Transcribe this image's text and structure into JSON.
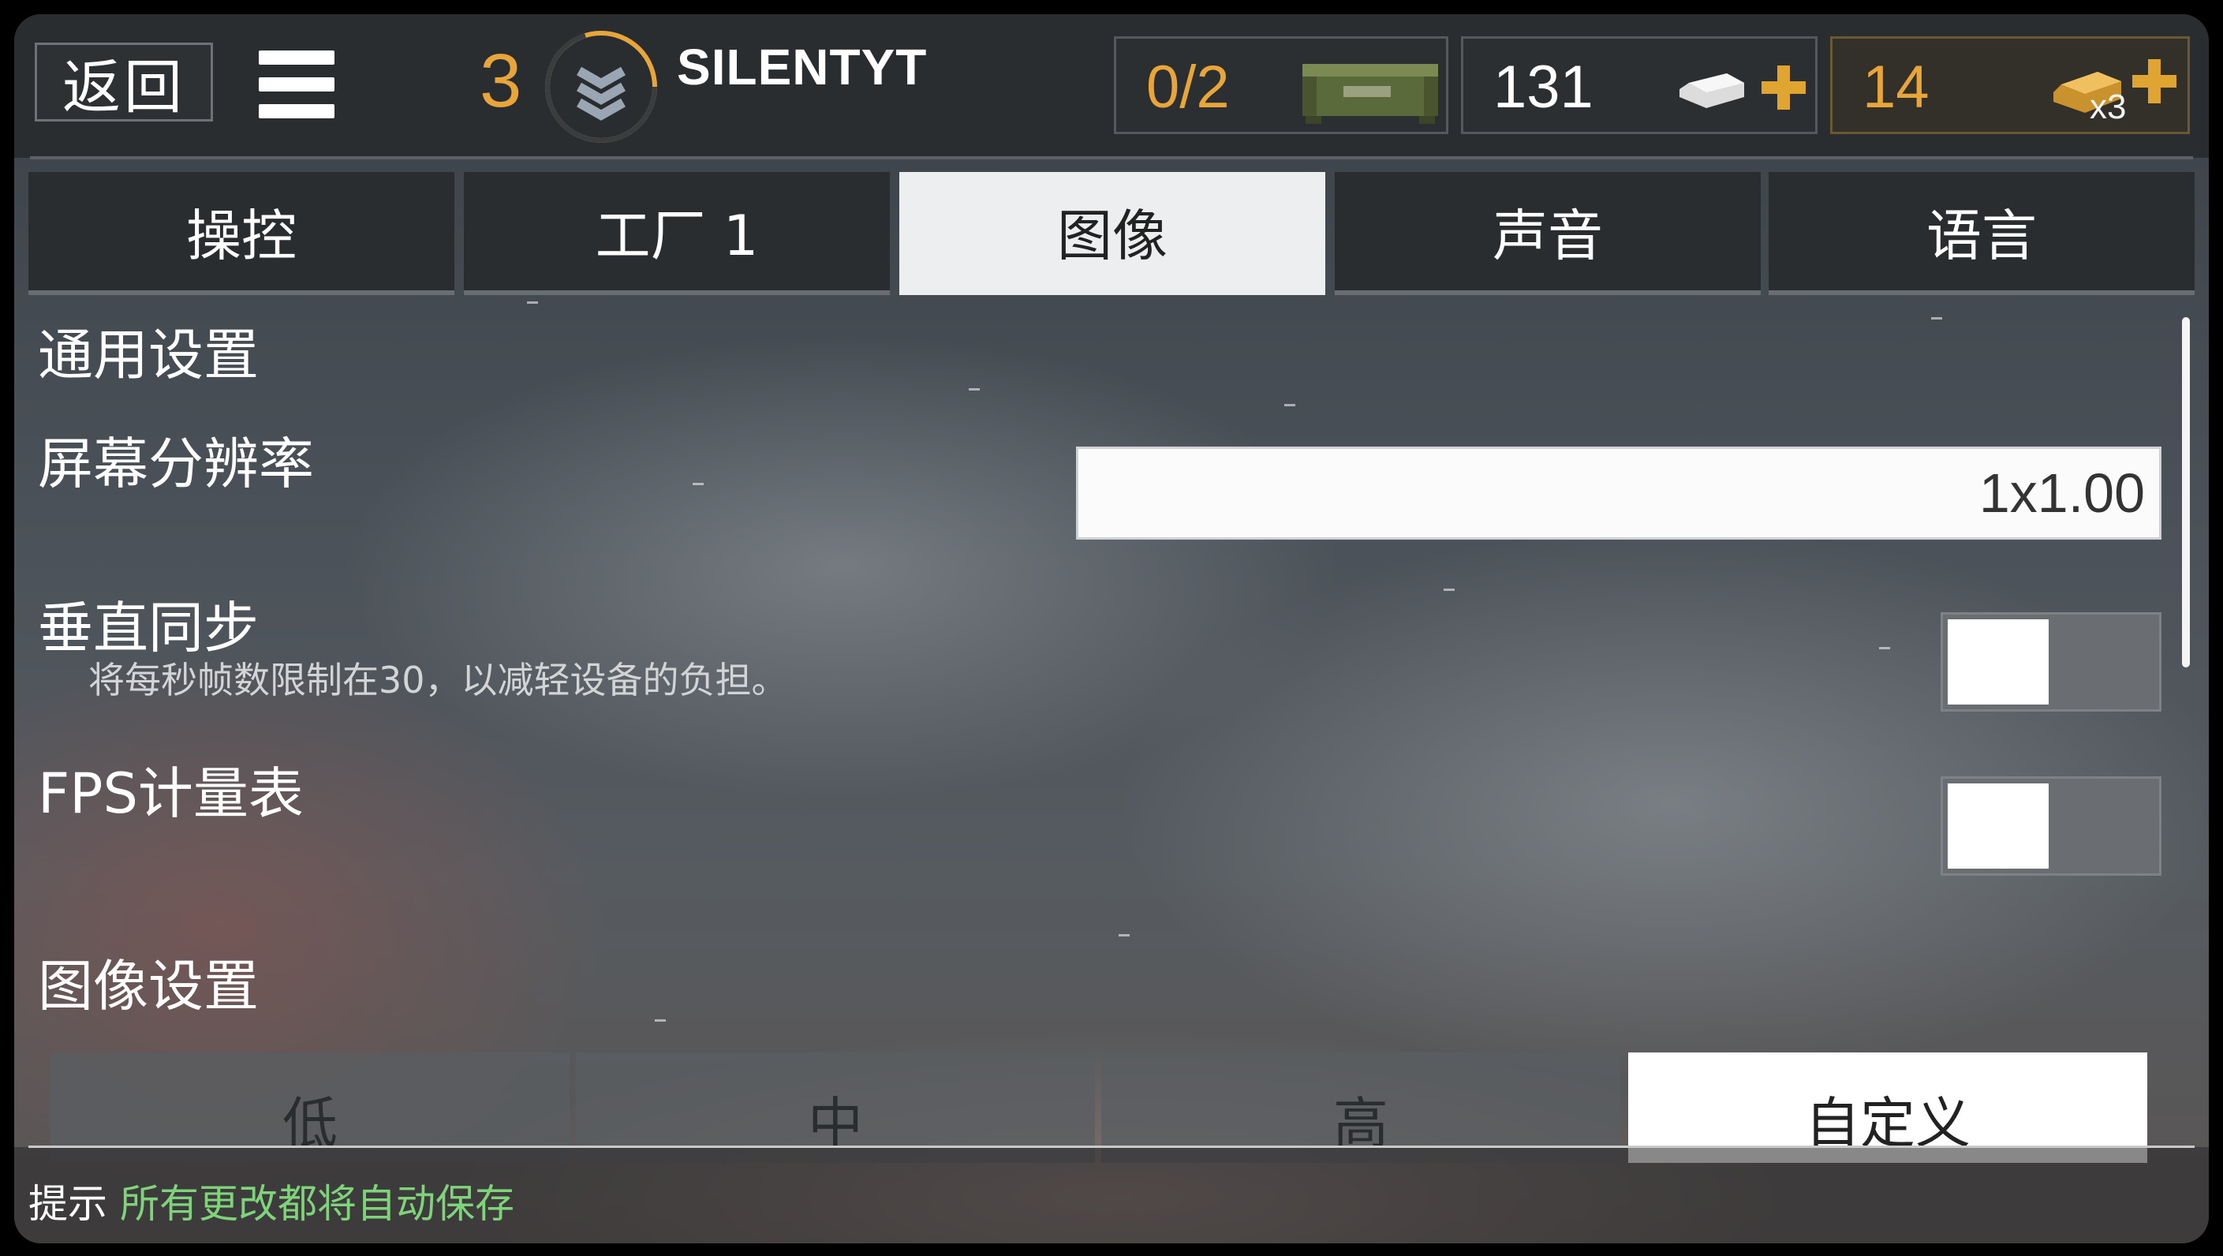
{
  "header": {
    "back_label": "返回",
    "rank": "3",
    "player_name": "SILENTYT",
    "crates": "0/2",
    "silver": "131",
    "gold": "14",
    "gold_multiplier": "x3",
    "colors": {
      "rank": "#e8a53a",
      "gold": "#e8a53a",
      "plus": "#e0a530"
    }
  },
  "tabs": [
    {
      "label": "操控",
      "active": false
    },
    {
      "label": "工厂 1",
      "active": false
    },
    {
      "label": "图像",
      "active": true
    },
    {
      "label": "声音",
      "active": false
    },
    {
      "label": "语言",
      "active": false
    }
  ],
  "general": {
    "title": "通用设置",
    "resolution_label": "屏幕分辨率",
    "resolution_value": "1x1.00",
    "vsync_label": "垂直同步",
    "vsync_desc": "将每秒帧数限制在30，以减轻设备的负担。",
    "vsync_on": false,
    "fps_label": "FPS计量表",
    "fps_on": false
  },
  "graphics": {
    "title": "图像设置",
    "presets": [
      {
        "label": "低",
        "active": false
      },
      {
        "label": "中",
        "active": false
      },
      {
        "label": "高",
        "active": false
      },
      {
        "label": "自定义",
        "active": true
      }
    ]
  },
  "footer": {
    "hint_label": "提示",
    "hint_text": "所有更改都将自动保存",
    "hint_color": "#7fd37a"
  }
}
